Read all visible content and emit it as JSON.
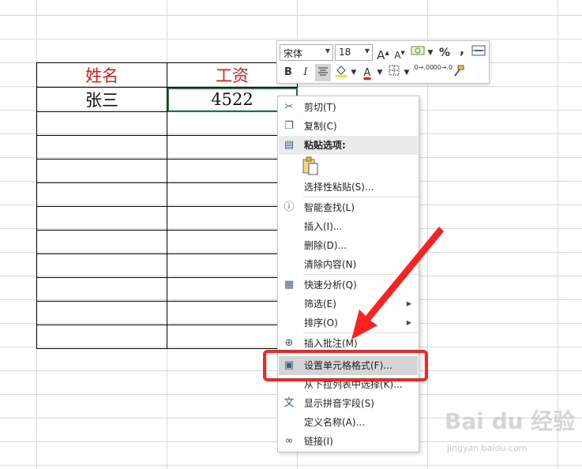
{
  "sheet": {
    "top_cutoff_text": "",
    "table": {
      "header": [
        "姓名",
        "工资"
      ],
      "rows": [
        [
          "张三",
          "4522"
        ]
      ],
      "empty_rows": 10
    }
  },
  "mini_toolbar": {
    "font_name": "宋体",
    "font_size": "18",
    "percent": "%",
    "comma": ",",
    "bold": "B",
    "italic": "I",
    "increase_font": "A",
    "decrease_font": "A",
    "font_color_letter": "A",
    "inc_decimal": ".0→.00",
    "dec_decimal": ".00→.0"
  },
  "context_menu": {
    "items": [
      {
        "label": "剪切(T)",
        "icon": "cut-icon"
      },
      {
        "label": "复制(C)",
        "icon": "copy-icon"
      },
      {
        "label": "粘贴选项:",
        "icon": "paste-icon",
        "header": true
      },
      {
        "label": "选择性粘贴(S)...",
        "icon": ""
      },
      {
        "label": "智能查找(L)",
        "icon": "smart-lookup-icon"
      },
      {
        "label": "插入(I)...",
        "icon": ""
      },
      {
        "label": "删除(D)...",
        "icon": ""
      },
      {
        "label": "清除内容(N)",
        "icon": ""
      },
      {
        "label": "快速分析(Q)",
        "icon": "quick-analysis-icon"
      },
      {
        "label": "筛选(E)",
        "icon": "",
        "submenu": true
      },
      {
        "label": "排序(O)",
        "icon": "",
        "submenu": true
      },
      {
        "label": "插入批注(M)",
        "icon": "insert-comment-icon"
      },
      {
        "label": "设置单元格格式(F)...",
        "icon": "format-cells-icon",
        "highlighted": true
      },
      {
        "label": "从下拉列表中选择(K)...",
        "icon": ""
      },
      {
        "label": "显示拼音字段(S)",
        "icon": "phonetic-icon"
      },
      {
        "label": "定义名称(A)...",
        "icon": ""
      },
      {
        "label": "链接(I)",
        "icon": "link-icon"
      }
    ]
  },
  "watermark": {
    "main": "Bai du 经验",
    "sub": "jingyan.baidu.com"
  },
  "colors": {
    "header_text": "#e0201b",
    "selection": "#217346",
    "annotation": "#ff2020"
  }
}
